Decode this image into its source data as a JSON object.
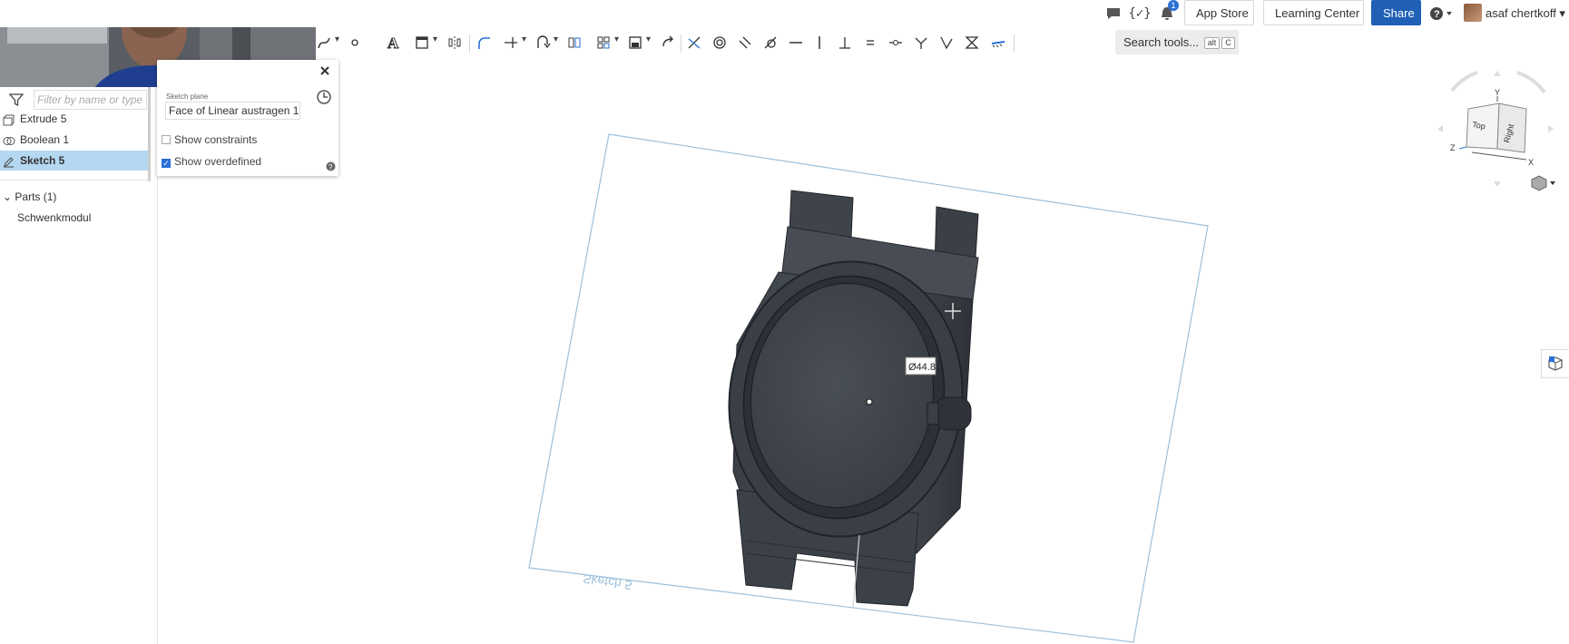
{
  "header": {
    "app_store": "App Store",
    "learning_center": "Learning Center",
    "share": "Share",
    "user_name": "asaf chertkoff",
    "notification_count": "1"
  },
  "toolbar": {
    "search_label": "Search tools...",
    "search_shortcut_1": "alt",
    "search_shortcut_2": "C"
  },
  "feature_tree": {
    "filter_placeholder": "Filter by name or type",
    "items": [
      {
        "label": "Extrude 5",
        "icon": "extrude-icon"
      },
      {
        "label": "Boolean 1",
        "icon": "boolean-icon"
      },
      {
        "label": "Sketch 5",
        "icon": "sketch-icon",
        "selected": true
      }
    ],
    "parts_header": "Parts (1)",
    "parts": [
      "Schwenkmodul"
    ]
  },
  "sketch_dialog": {
    "plane_label": "Sketch plane",
    "plane_value": "Face of Linear austragen 1",
    "show_constraints": "Show constraints",
    "show_constraints_checked": false,
    "show_overdefined": "Show overdefined",
    "show_overdefined_checked": true
  },
  "viewport": {
    "sketch_plane_name": "Sketch 5",
    "dimension_label": "Ø44.8"
  },
  "view_cube": {
    "top": "Top",
    "right": "Right",
    "axis_x": "X",
    "axis_y": "Y",
    "axis_z": "Z"
  }
}
